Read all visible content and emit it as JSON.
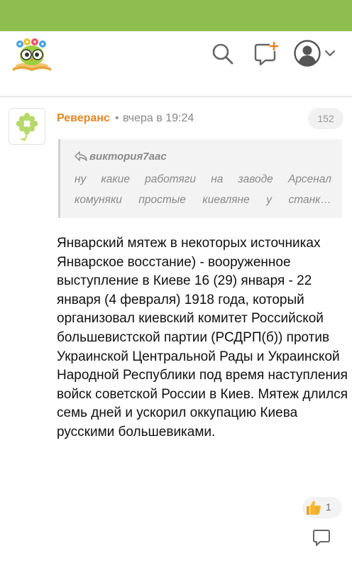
{
  "header": {
    "icons": {
      "logo": "owl-books-logo",
      "search": "search-icon",
      "ask": "chat-add-icon",
      "profile": "user-avatar-icon",
      "menu": "chevron-down-icon"
    },
    "colors": {
      "topbar": "#8fbe4e",
      "accent": "#e58626"
    }
  },
  "post": {
    "author": "Реверанс",
    "separator": "•",
    "time": "вчера в 19:24",
    "views": "152",
    "quote": {
      "author": "виктория7аас",
      "line1": "ну какие работяги на заводе Арсенал",
      "line2_words": [
        "комуняки",
        "простые",
        "киевляне",
        "у",
        "станк…"
      ]
    },
    "text": "Январский мятеж в некоторых источниках Январское восстание) - вооруженное выступление в Киеве 16 (29) января - 22 января (4 февраля) 1918 года, который организовал киевский комитет Российской большевистской партии (РСДРП(б)) против Украинской Центральной Рады и Украинской Народной Республики под время наступления войск советской России в Киев. Мятеж длился семь дней и ускорил оккупацию Киева русскими большевиками.",
    "likes": "1"
  }
}
